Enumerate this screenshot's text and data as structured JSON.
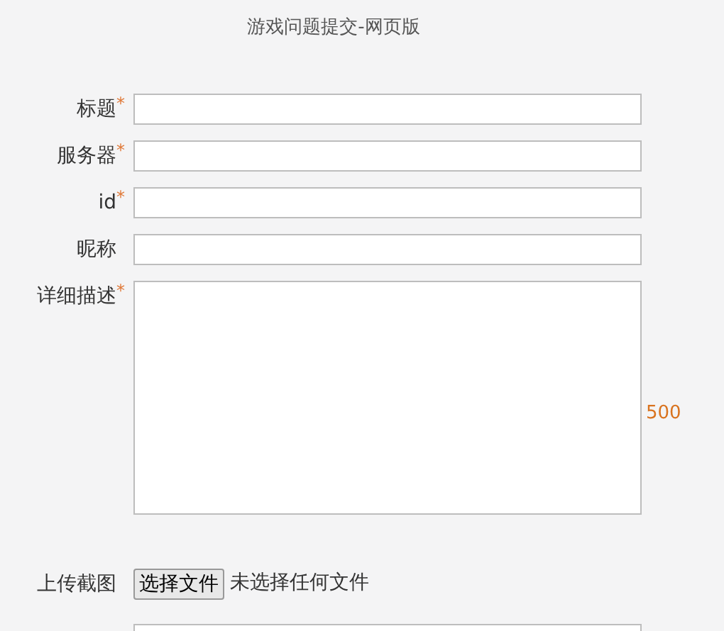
{
  "title": "游戏问题提交-网页版",
  "fields": [
    {
      "kind": "input",
      "label": "标题",
      "required_mark": "*"
    },
    {
      "kind": "input",
      "label": "服务器",
      "required_mark": "*"
    },
    {
      "kind": "input",
      "label": "id",
      "required_mark": "*"
    },
    {
      "kind": "input",
      "label": "昵称"
    },
    {
      "kind": "textarea",
      "label": "详细描述",
      "required_mark": "*",
      "counter": "500"
    },
    {
      "kind": "file",
      "label": "上传截图",
      "button": "选择文件",
      "status": "未选择任何文件"
    },
    {
      "kind": "input_cut"
    }
  ]
}
